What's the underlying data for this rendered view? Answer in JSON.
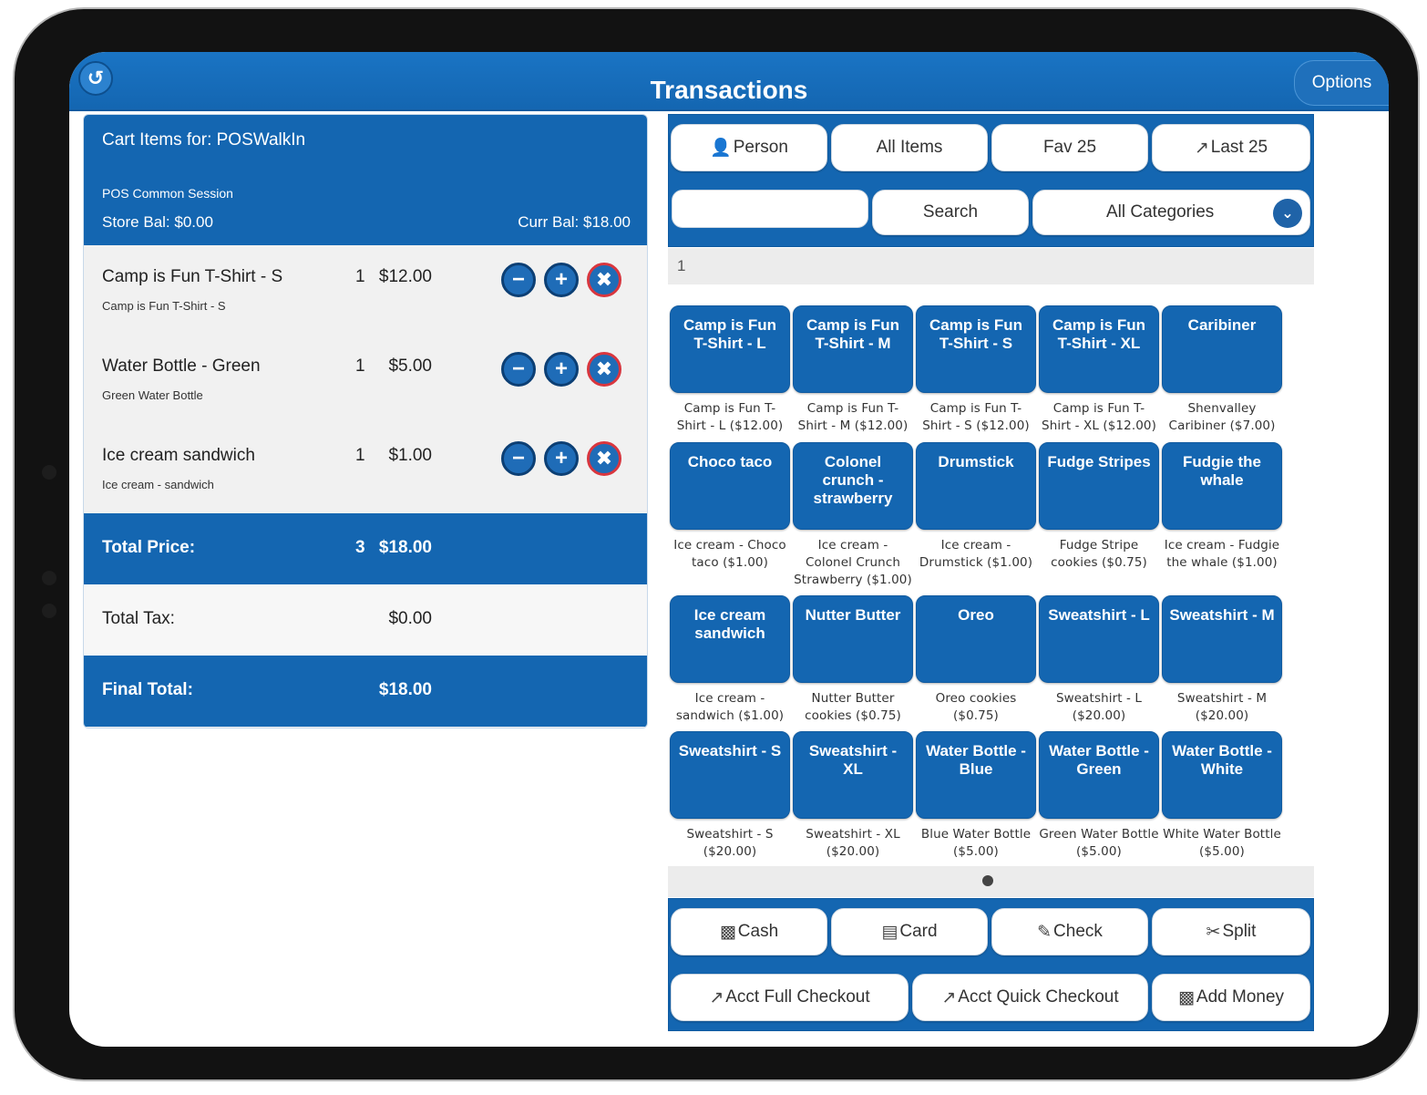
{
  "header": {
    "title": "Transactions",
    "options_label": "Options"
  },
  "cart": {
    "for_label": "Cart Items for: POSWalkIn",
    "session": "POS Common Session",
    "store_bal": "Store Bal: $0.00",
    "curr_bal": "Curr Bal: $18.00",
    "items": [
      {
        "name": "Camp is Fun T-Shirt - S",
        "desc": "Camp is Fun T-Shirt - S",
        "qty": "1",
        "price": "$12.00"
      },
      {
        "name": "Water Bottle - Green",
        "desc": "Green Water Bottle",
        "qty": "1",
        "price": "$5.00"
      },
      {
        "name": "Ice cream sandwich",
        "desc": "Ice cream - sandwich",
        "qty": "1",
        "price": "$1.00"
      }
    ],
    "total_price": {
      "label": "Total Price:",
      "qty": "3",
      "amount": "$18.00"
    },
    "total_tax": {
      "label": "Total Tax:",
      "amount": "$0.00"
    },
    "final_total": {
      "label": "Final Total:",
      "amount": "$18.00"
    }
  },
  "filters": {
    "person": "Person",
    "all_items": "All Items",
    "fav25": "Fav 25",
    "last25": "Last 25",
    "search_value": "",
    "search_button": "Search",
    "category": "All Categories"
  },
  "page_indicator": "1",
  "products": [
    {
      "label": "Camp is Fun T-Shirt - L",
      "caption": "Camp is Fun T-Shirt - L ($12.00)"
    },
    {
      "label": "Camp is Fun T-Shirt - M",
      "caption": "Camp is Fun T-Shirt - M ($12.00)"
    },
    {
      "label": "Camp is Fun T-Shirt - S",
      "caption": "Camp is Fun T-Shirt - S ($12.00)"
    },
    {
      "label": "Camp is Fun T-Shirt - XL",
      "caption": "Camp is Fun T-Shirt - XL ($12.00)"
    },
    {
      "label": "Caribiner",
      "caption": "Shenvalley Caribiner ($7.00)"
    },
    {
      "label": "Choco taco",
      "caption": "Ice cream - Choco taco ($1.00)"
    },
    {
      "label": "Colonel crunch - strawberry",
      "caption": "Ice cream - Colonel Crunch Strawberry ($1.00)"
    },
    {
      "label": "Drumstick",
      "caption": "Ice cream - Drumstick ($1.00)"
    },
    {
      "label": "Fudge Stripes",
      "caption": "Fudge Stripe cookies ($0.75)"
    },
    {
      "label": "Fudgie the whale",
      "caption": "Ice cream - Fudgie the whale ($1.00)"
    },
    {
      "label": "Ice cream sandwich",
      "caption": "Ice cream - sandwich ($1.00)"
    },
    {
      "label": "Nutter Butter",
      "caption": "Nutter Butter cookies ($0.75)"
    },
    {
      "label": "Oreo",
      "caption": "Oreo cookies ($0.75)"
    },
    {
      "label": "Sweatshirt - L",
      "caption": "Sweatshirt - L ($20.00)"
    },
    {
      "label": "Sweatshirt - M",
      "caption": "Sweatshirt - M ($20.00)"
    },
    {
      "label": "Sweatshirt - S",
      "caption": "Sweatshirt - S ($20.00)"
    },
    {
      "label": "Sweatshirt - XL",
      "caption": "Sweatshirt - XL ($20.00)"
    },
    {
      "label": "Water Bottle - Blue",
      "caption": "Blue Water Bottle ($5.00)"
    },
    {
      "label": "Water Bottle - Green",
      "caption": "Green Water Bottle ($5.00)"
    },
    {
      "label": "Water Bottle - White",
      "caption": "White Water Bottle ($5.00)"
    }
  ],
  "payment": {
    "cash": "Cash",
    "card": "Card",
    "check": "Check",
    "split": "Split",
    "acct_full": "Acct Full Checkout",
    "acct_quick": "Acct Quick Checkout",
    "add_money": "Add Money"
  },
  "icons": {
    "back": "back-arrow-icon",
    "person": "person-icon",
    "last25": "external-link-icon",
    "category": "chevron-down-icon",
    "cash": "cash-icon",
    "card": "credit-card-icon",
    "check": "check-pencil-icon",
    "split": "scissors-icon",
    "acct": "share-icon",
    "minus": "minus-icon",
    "plus": "plus-icon",
    "remove": "remove-icon"
  },
  "colors": {
    "primary": "#1466b1",
    "delete_ring": "#d9363e",
    "panel_bg": "#f1f1f1"
  }
}
